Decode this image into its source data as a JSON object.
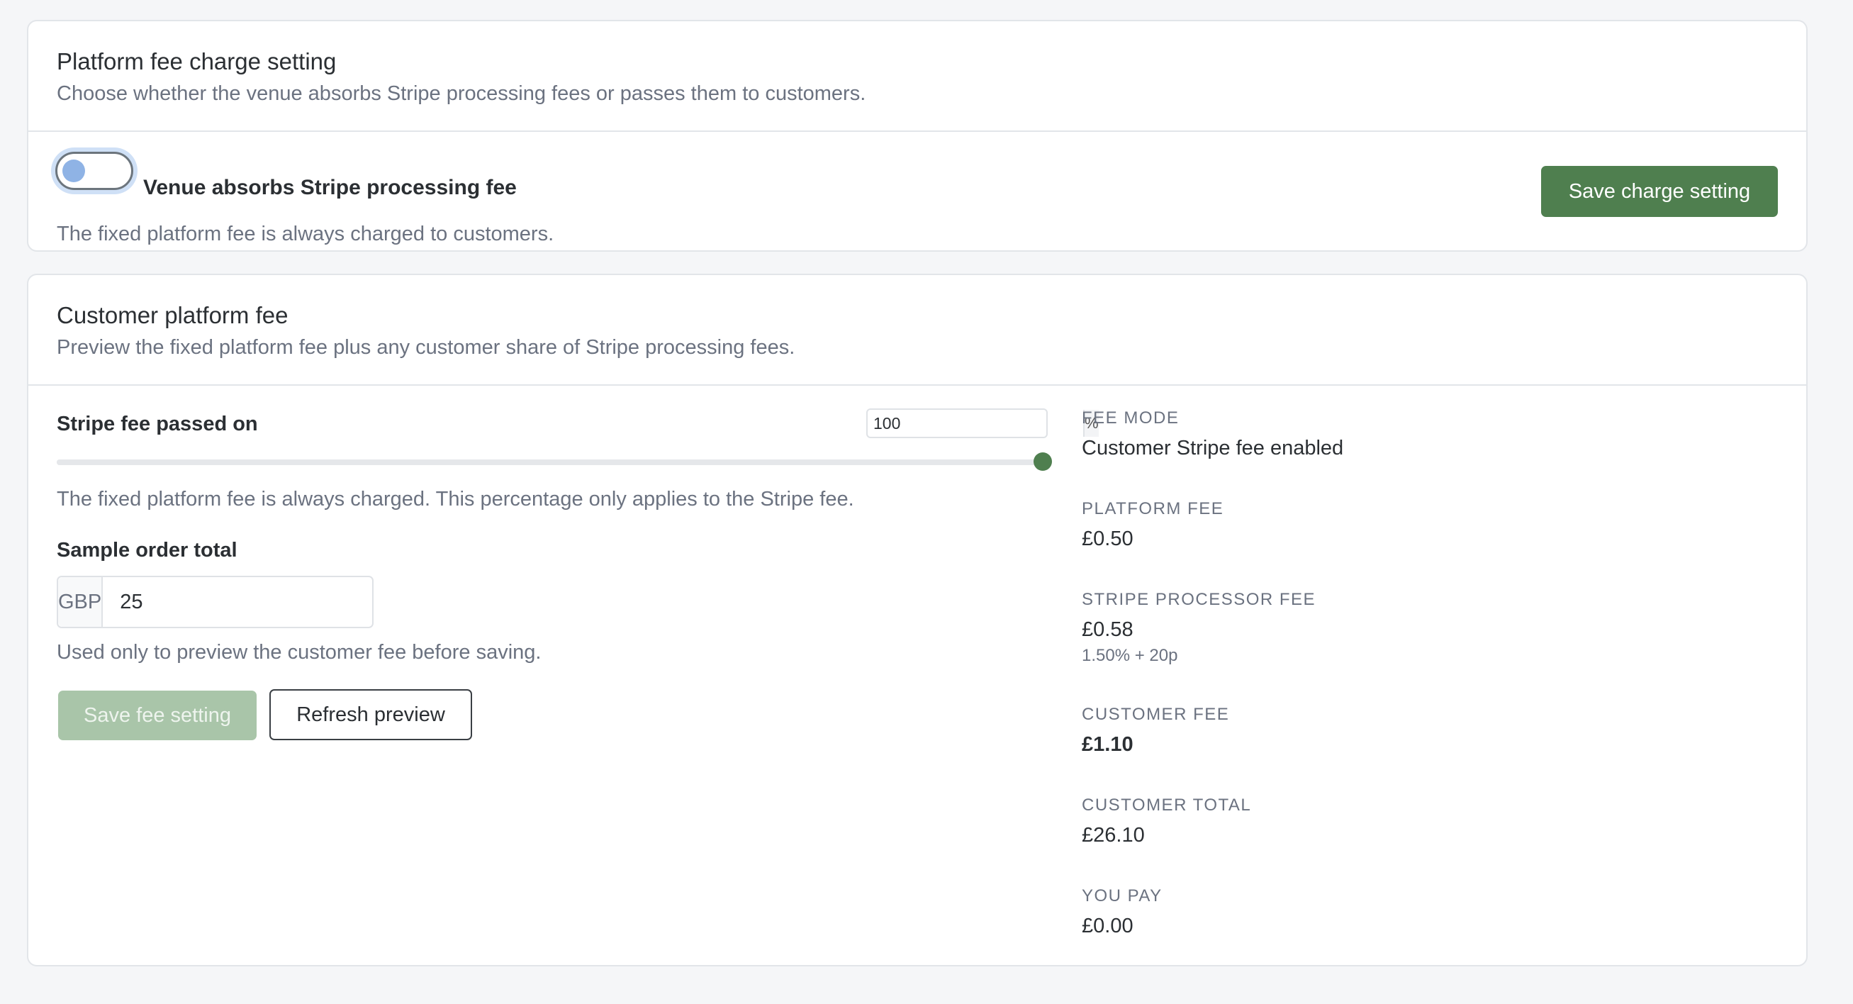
{
  "charge_setting": {
    "title": "Platform fee charge setting",
    "subtitle": "Choose whether the venue absorbs Stripe processing fees or passes them to customers.",
    "toggle_label": "Venue absorbs Stripe processing fee",
    "toggle_on": false,
    "help": "The fixed platform fee is always charged to customers.",
    "save_label": "Save charge setting"
  },
  "customer_fee": {
    "title": "Customer platform fee",
    "subtitle": "Preview the fixed platform fee plus any customer share of Stripe processing fees.",
    "stripe_label": "Stripe fee passed on",
    "percent_value": "100",
    "percent_suffix": "%",
    "slider_value": 100,
    "slider_help": "The fixed platform fee is always charged. This percentage only applies to the Stripe fee.",
    "sample_label": "Sample order total",
    "currency": "GBP",
    "sample_value": "25",
    "sample_help": "Used only to preview the customer fee before saving.",
    "save_label": "Save fee setting",
    "refresh_label": "Refresh preview"
  },
  "summary": {
    "fee_mode_label": "FEE MODE",
    "fee_mode_value": "Customer Stripe fee enabled",
    "platform_fee_label": "PLATFORM FEE",
    "platform_fee_value": "£0.50",
    "stripe_fee_label": "STRIPE PROCESSOR FEE",
    "stripe_fee_value": "£0.58",
    "stripe_fee_note": "1.50% + 20p",
    "customer_fee_label": "CUSTOMER FEE",
    "customer_fee_value": "£1.10",
    "customer_total_label": "CUSTOMER TOTAL",
    "customer_total_value": "£26.10",
    "you_pay_label": "YOU PAY",
    "you_pay_value": "£0.00"
  },
  "colors": {
    "accent": "#4f7f4f",
    "accent_disabled": "#a9c5a9",
    "focus_ring": "#cfe0f6"
  }
}
